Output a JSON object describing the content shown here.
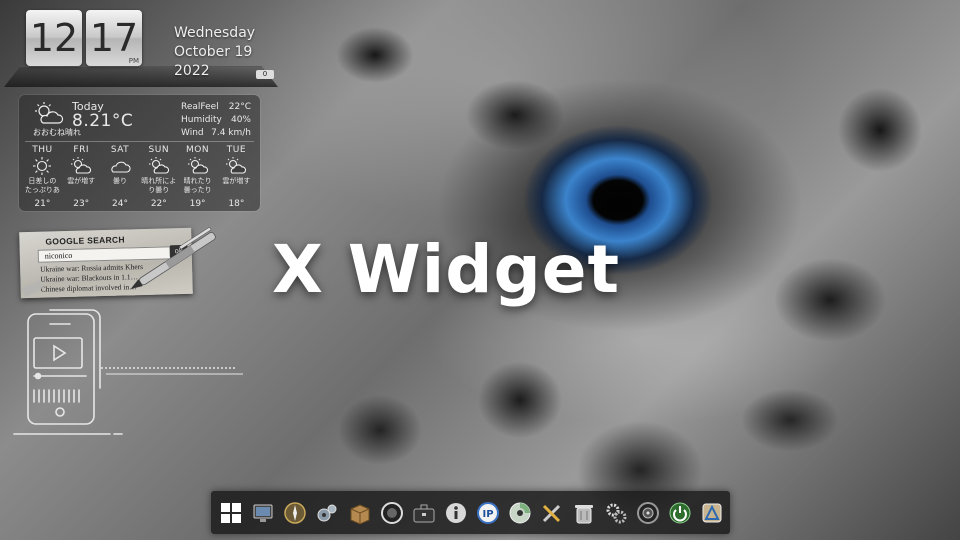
{
  "clock": {
    "hour": "12",
    "minute": "17",
    "ampm": "PM",
    "counter": "0"
  },
  "date": {
    "weekday": "Wednesday",
    "month_day": "October 19",
    "year": "2022"
  },
  "weather": {
    "today_label": "Today",
    "temperature": "8.21°C",
    "condition": "おおむね晴れ",
    "realfeel_label": "RealFeel",
    "realfeel_value": "22°C",
    "humidity_label": "Humidity",
    "humidity_value": "40%",
    "wind_label": "Wind",
    "wind_value": "7.4 km/h",
    "forecast": [
      {
        "day": "THU",
        "icon": "sun-icon",
        "cond1": "日差しの",
        "cond2": "たっぷりある",
        "temp": "21°"
      },
      {
        "day": "FRI",
        "icon": "partly-cloudy-icon",
        "cond1": "雲が増す",
        "cond2": "",
        "temp": "23°"
      },
      {
        "day": "SAT",
        "icon": "cloud-icon",
        "cond1": "曇り",
        "cond2": "",
        "temp": "24°"
      },
      {
        "day": "SUN",
        "icon": "partly-cloudy-icon",
        "cond1": "晴れ所によ",
        "cond2": "り曇り",
        "temp": "22°"
      },
      {
        "day": "MON",
        "icon": "partly-cloudy-icon",
        "cond1": "晴れたり",
        "cond2": "曇ったり",
        "temp": "19°"
      },
      {
        "day": "TUE",
        "icon": "partly-cloudy-icon",
        "cond1": "雲が増す",
        "cond2": "",
        "temp": "18°"
      }
    ]
  },
  "google": {
    "title": "GOOGLE SEARCH",
    "query": "niconico",
    "go_label": "ok",
    "headlines": [
      "Ukraine war: Russia admits Khers",
      "Ukraine war: Blackouts in 1.1…",
      "Chinese diplomat involved in…"
    ]
  },
  "title": "X Widget",
  "dock": {
    "icons": [
      "windows-start-icon",
      "monitor-icon",
      "compass-icon",
      "gears-icon",
      "package-box-icon",
      "dial-icon",
      "briefcase-icon",
      "info-icon",
      "ip-icon",
      "disc-icon",
      "tools-icon",
      "trash-icon",
      "settings-gears-icon",
      "speaker-icon",
      "power-icon",
      "app-store-icon"
    ]
  }
}
